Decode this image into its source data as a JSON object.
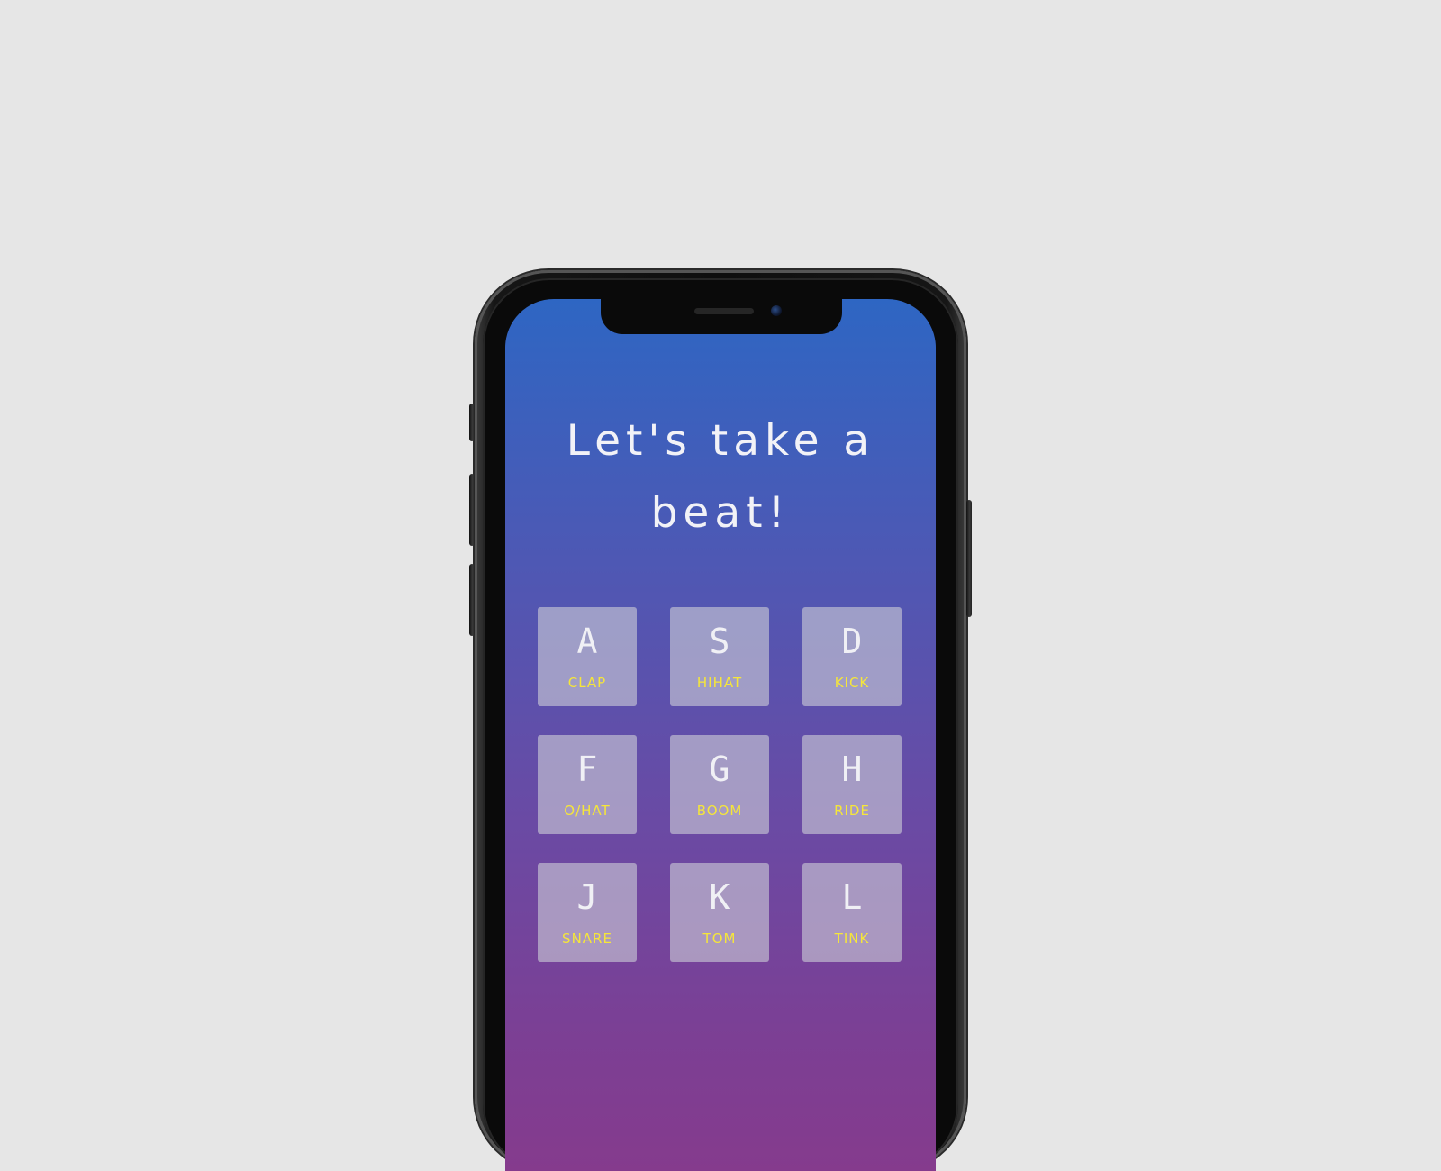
{
  "app": {
    "title_line1": "Let's take a",
    "title_line2": "beat!"
  },
  "pads": [
    {
      "key": "A",
      "sound": "CLAP"
    },
    {
      "key": "S",
      "sound": "HIHAT"
    },
    {
      "key": "D",
      "sound": "KICK"
    },
    {
      "key": "F",
      "sound": "O/HAT"
    },
    {
      "key": "G",
      "sound": "BOOM"
    },
    {
      "key": "H",
      "sound": "RIDE"
    },
    {
      "key": "J",
      "sound": "SNARE"
    },
    {
      "key": "K",
      "sound": "TOM"
    },
    {
      "key": "L",
      "sound": "TINK"
    }
  ],
  "colors": {
    "gradient_top": "#2e66c3",
    "gradient_bottom": "#853b8d",
    "pad_background": "#cccfd6",
    "sound_label": "#f5e63a",
    "key_label": "#f0f0f5",
    "page_background": "#e6e6e6"
  }
}
